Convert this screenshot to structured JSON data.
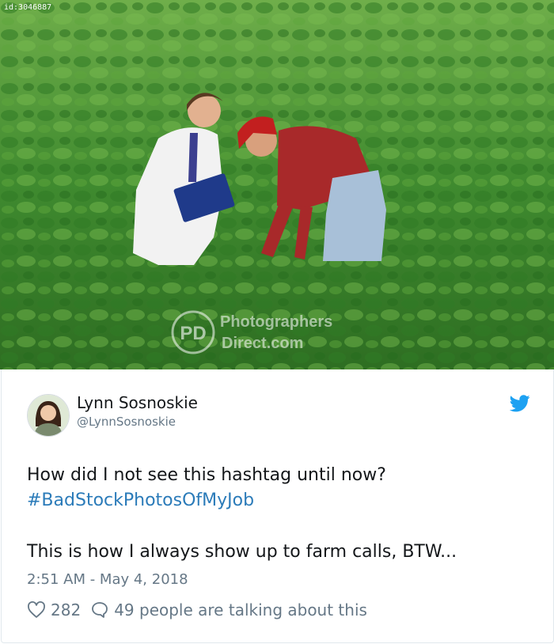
{
  "image": {
    "id_label": "id:3046887",
    "watermark_icon": "PD",
    "watermark_line1": "Photographers",
    "watermark_line2": "Direct.com"
  },
  "tweet": {
    "author_name": "Lynn Sosnoskie",
    "author_handle": "@LynnSosnoskie",
    "line1": "How did I not see this hashtag until now?",
    "hashtag": "#BadStockPhotosOfMyJob",
    "line3": "This is how I always show up to farm calls, BTW...",
    "timestamp": "2:51 AM - May 4, 2018",
    "likes": "282",
    "talking": "49 people are talking about this"
  },
  "colors": {
    "link": "#2b7bb9",
    "twitter_blue": "#1da1f2",
    "muted": "#657786"
  },
  "icons": {
    "like": "heart-icon",
    "reply": "speech-bubble-icon",
    "brand": "twitter-bird-icon"
  }
}
